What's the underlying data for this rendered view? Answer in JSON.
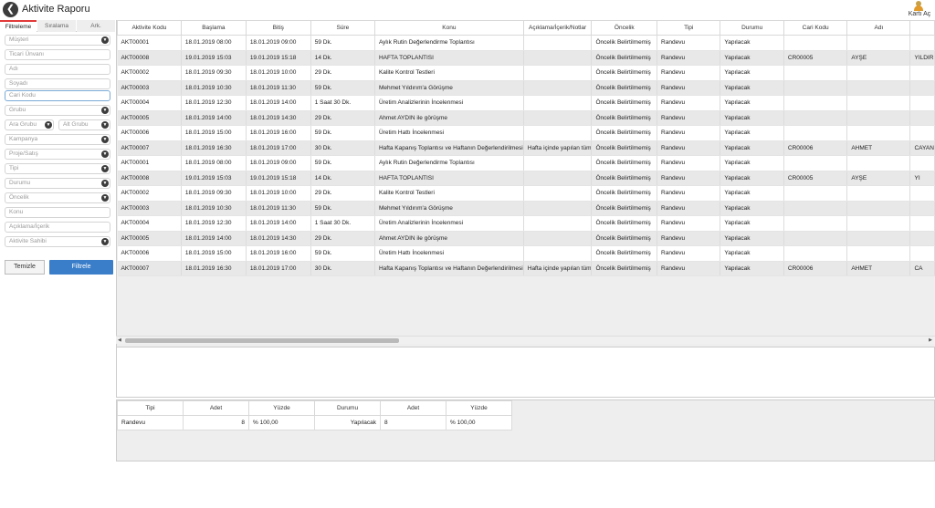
{
  "header": {
    "back_icon": "arrow-left-icon",
    "title": "Aktivite Raporu",
    "card_label": "Kartı Aç",
    "card_icon": "user-card-icon"
  },
  "sidebar": {
    "tabs": [
      "Filtreleme",
      "Sıralama",
      "Ark."
    ],
    "fields": {
      "musteri": "Müşteri",
      "ticari_unvani": "Ticari Ünvanı",
      "adi": "Adı",
      "soyadi": "Soyadı",
      "cari_kodu": "Cari Kodu",
      "grubu": "Grubu",
      "ara_grubu": "Ara Grubu",
      "alt_grubu": "Alt Grubu",
      "kampanya": "Kampanya",
      "proje_satis": "Proje/Satış",
      "tipi": "Tipi",
      "durumu": "Durumu",
      "oncelik": "Öncelik",
      "konu": "Konu",
      "aciklama": "Açıklama/İçerik",
      "aktivite_sahibi": "Aktivite Sahibi"
    },
    "clear_label": "Temizle",
    "filter_label": "Filtrele"
  },
  "table": {
    "columns": [
      "Aktivite Kodu",
      "Başlama",
      "Bitiş",
      "Süre",
      "Konu",
      "Açıklama/İçerik/Notlar",
      "Öncelik",
      "Tipi",
      "Durumu",
      "Cari Kodu",
      "Adı",
      ""
    ],
    "rows": [
      [
        "AKT00001",
        "18.01.2019 08:00",
        "18.01.2019 09:00",
        "59 Dk.",
        "Aylık Rutin Değerlendirme Toplantısı",
        "",
        "Öncelik Belirtilmemiş",
        "Randevu",
        "Yapılacak",
        "",
        "",
        ""
      ],
      [
        "AKT00008",
        "19.01.2019 15:03",
        "19.01.2019 15:18",
        "14 Dk.",
        "HAFTA TOPLANTISI",
        "",
        "Öncelik Belirtilmemiş",
        "Randevu",
        "Yapılacak",
        "CR00005",
        "AYŞE",
        "YILDIR"
      ],
      [
        "AKT00002",
        "18.01.2019 09:30",
        "18.01.2019 10:00",
        "29 Dk.",
        "Kalite Kontrol Testleri",
        "",
        "Öncelik Belirtilmemiş",
        "Randevu",
        "Yapılacak",
        "",
        "",
        ""
      ],
      [
        "AKT00003",
        "18.01.2019 10:30",
        "18.01.2019 11:30",
        "59 Dk.",
        "Mehmet Yıldırım'a Görüşme",
        "",
        "Öncelik Belirtilmemiş",
        "Randevu",
        "Yapılacak",
        "",
        "",
        ""
      ],
      [
        "AKT00004",
        "18.01.2019 12:30",
        "18.01.2019 14:00",
        "1 Saat 30 Dk.",
        "Üretim Analizlerinin İncelenmesi",
        "",
        "Öncelik Belirtilmemiş",
        "Randevu",
        "Yapılacak",
        "",
        "",
        ""
      ],
      [
        "AKT00005",
        "18.01.2019 14:00",
        "18.01.2019 14:30",
        "29 Dk.",
        "Ahmet AYDIN ile görüşme",
        "",
        "Öncelik Belirtilmemiş",
        "Randevu",
        "Yapılacak",
        "",
        "",
        ""
      ],
      [
        "AKT00006",
        "18.01.2019 15:00",
        "18.01.2019 16:00",
        "59 Dk.",
        "Üretim Hattı İncelenmesi",
        "",
        "Öncelik Belirtilmemiş",
        "Randevu",
        "Yapılacak",
        "",
        "",
        ""
      ],
      [
        "AKT00007",
        "18.01.2019 16:30",
        "18.01.2019 17:00",
        "30 Dk.",
        "Hafta Kapanış Toplantısı ve Haftanın Değerlendirilmesi",
        "Hafta içinde yapılan tüm",
        "Öncelik Belirtilmemiş",
        "Randevu",
        "Yapılacak",
        "CR00006",
        "AHMET",
        "CAYAN"
      ],
      [
        "AKT00001",
        "18.01.2019 08:00",
        "18.01.2019 09:00",
        "59 Dk.",
        "Aylık Rutin Değerlendirme Toplantısı",
        "",
        "Öncelik Belirtilmemiş",
        "Randevu",
        "Yapılacak",
        "",
        "",
        ""
      ],
      [
        "AKT00008",
        "19.01.2019 15:03",
        "19.01.2019 15:18",
        "14 Dk.",
        "HAFTA TOPLANTISI",
        "",
        "Öncelik Belirtilmemiş",
        "Randevu",
        "Yapılacak",
        "CR00005",
        "AYŞE",
        "YI"
      ],
      [
        "AKT00002",
        "18.01.2019 09:30",
        "18.01.2019 10:00",
        "29 Dk.",
        "Kalite Kontrol Testleri",
        "",
        "Öncelik Belirtilmemiş",
        "Randevu",
        "Yapılacak",
        "",
        "",
        ""
      ],
      [
        "AKT00003",
        "18.01.2019 10:30",
        "18.01.2019 11:30",
        "59 Dk.",
        "Mehmet Yıldırım'a Görüşme",
        "",
        "Öncelik Belirtilmemiş",
        "Randevu",
        "Yapılacak",
        "",
        "",
        ""
      ],
      [
        "AKT00004",
        "18.01.2019 12:30",
        "18.01.2019 14:00",
        "1 Saat 30 Dk.",
        "Üretim Analizlerinin İncelenmesi",
        "",
        "Öncelik Belirtilmemiş",
        "Randevu",
        "Yapılacak",
        "",
        "",
        ""
      ],
      [
        "AKT00005",
        "18.01.2019 14:00",
        "18.01.2019 14:30",
        "29 Dk.",
        "Ahmet AYDIN ile görüşme",
        "",
        "Öncelik Belirtilmemiş",
        "Randevu",
        "Yapılacak",
        "",
        "",
        ""
      ],
      [
        "AKT00006",
        "18.01.2019 15:00",
        "18.01.2019 16:00",
        "59 Dk.",
        "Üretim Hattı İncelenmesi",
        "",
        "Öncelik Belirtilmemiş",
        "Randevu",
        "Yapılacak",
        "",
        "",
        ""
      ],
      [
        "AKT00007",
        "18.01.2019 16:30",
        "18.01.2019 17:00",
        "30 Dk.",
        "Hafta Kapanış Toplantısı ve Haftanın Değerlendirilmesi",
        "Hafta içinde yapılan tüm",
        "Öncelik Belirtilmemiş",
        "Randevu",
        "Yapılacak",
        "CR00006",
        "AHMET",
        "CA"
      ]
    ]
  },
  "summary": {
    "columns": [
      "Tipi",
      "Adet",
      "Yüzde",
      "Durumu",
      "Adet",
      "Yüzde"
    ],
    "rows": [
      [
        "Randevu",
        "8",
        "% 100,00",
        "Yapılacak",
        "8",
        "% 100,00"
      ]
    ]
  },
  "colors": {
    "filter_button": "#3a7ec9",
    "active_tab_accent": "#e23b3b",
    "alt_row": "#e8e8e8"
  }
}
